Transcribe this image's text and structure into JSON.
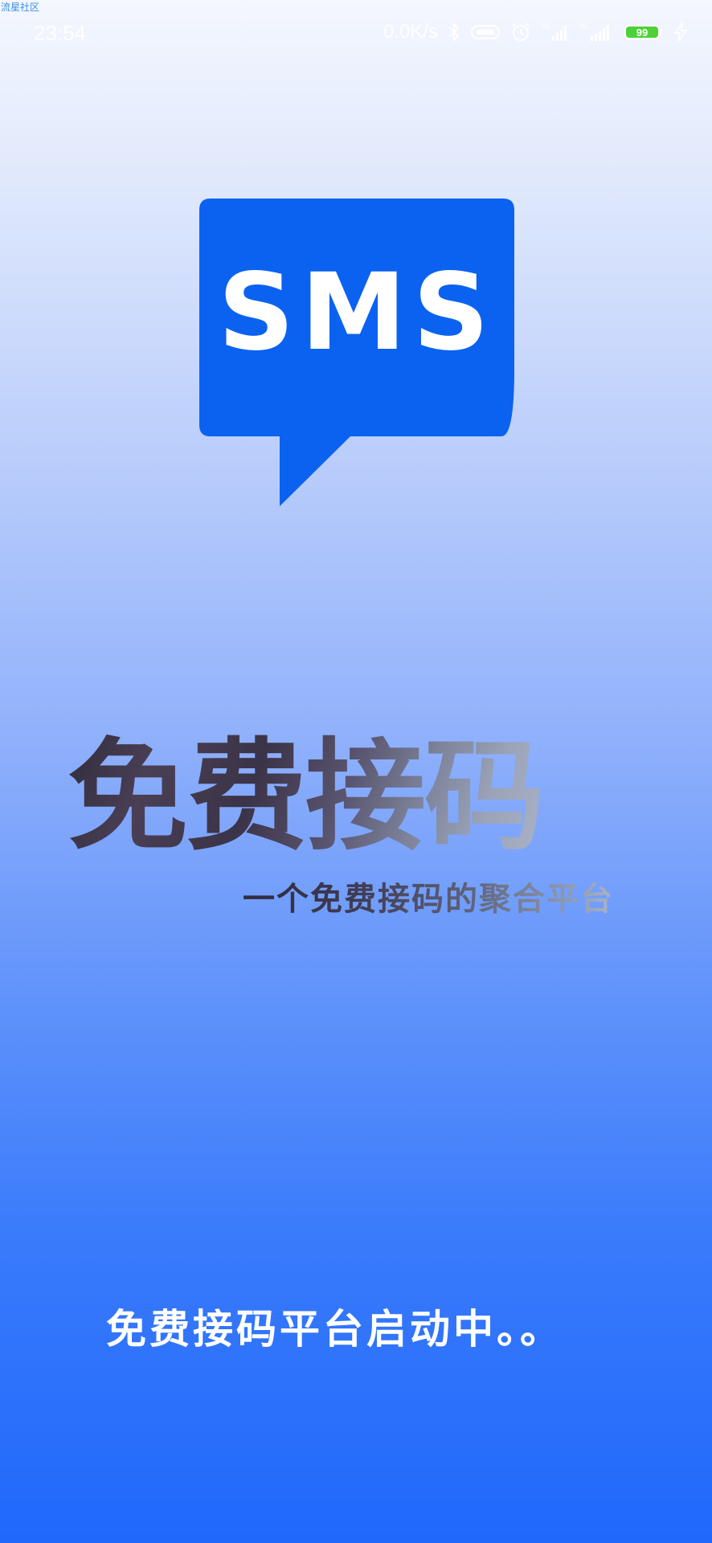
{
  "watermark": "流星社区",
  "status_bar": {
    "time": "23:54",
    "net_speed": "0.0K/s",
    "battery_level": "99",
    "icons": [
      "bluetooth-icon",
      "vr-icon",
      "alarm-icon",
      "signal-4g-icon",
      "signal-4g-icon",
      "battery-icon",
      "charging-icon"
    ]
  },
  "logo": {
    "text": "SMS",
    "color": "#0b62f0"
  },
  "headline": "免费接码",
  "subtitle": "一个免费接码的聚合平台",
  "loading_text": "免费接码平台启动中。。"
}
